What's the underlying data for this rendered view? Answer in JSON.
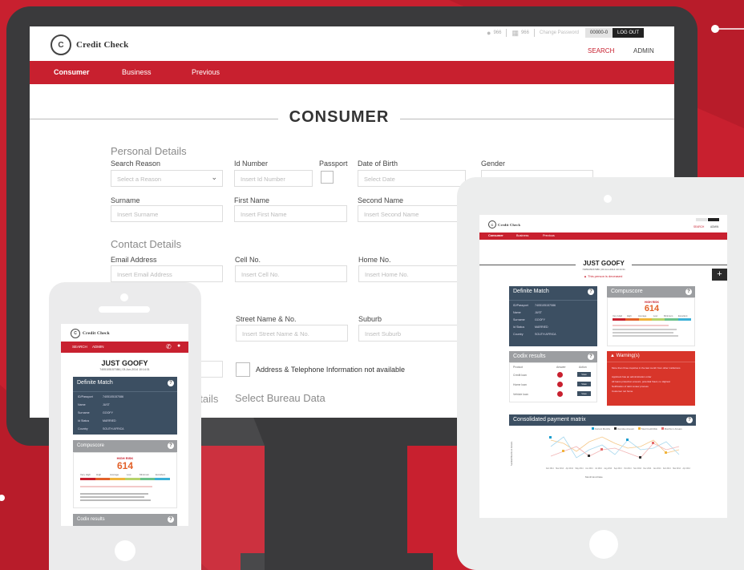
{
  "brand": {
    "name": "Credit Check"
  },
  "colors": {
    "brand_red": "#c8202f",
    "device_dark": "#3a3a3c",
    "device_light": "#ebebec",
    "navy": "#3c4f62",
    "gray_head": "#9c9ea1"
  },
  "desktop": {
    "header": {
      "user_count": "966",
      "branch_count": "966",
      "change_password": "Change Password",
      "code": "00000-0",
      "logout": "LOG OUT",
      "search_link": "SEARCH",
      "admin_link": "ADMIN"
    },
    "nav": [
      {
        "label": "Consumer"
      },
      {
        "label": "Business"
      },
      {
        "label": "Previous"
      }
    ],
    "page_title": "CONSUMER",
    "personal_details": {
      "title": "Personal Details",
      "search_reason": {
        "label": "Search Reason",
        "placeholder": "Select a Reason"
      },
      "id_number": {
        "label": "Id Number",
        "placeholder": "Insert Id Number"
      },
      "passport": {
        "label": "Passport"
      },
      "dob": {
        "label": "Date of Birth",
        "placeholder": "Select Date"
      },
      "gender": {
        "label": "Gender"
      },
      "surname": {
        "label": "Surname",
        "placeholder": "Insert Surname"
      },
      "first_name": {
        "label": "First Name",
        "placeholder": "Insert First Name"
      },
      "second_name": {
        "label": "Second Name",
        "placeholder": "Insert Second Name"
      }
    },
    "contact_details": {
      "title": "Contact Details",
      "email": {
        "label": "Email Address",
        "placeholder": "Insert Email Address"
      },
      "cell": {
        "label": "Cell No.",
        "placeholder": "Insert Cell No."
      },
      "home": {
        "label": "Home No.",
        "placeholder": "Insert Home No."
      }
    },
    "address": {
      "street": {
        "label": "Street Name & No.",
        "placeholder": "Insert Street Name & No."
      },
      "suburb": {
        "label": "Suburb",
        "placeholder": "Insert Suburb"
      },
      "unavailable_label": "Address & Telephone Information not available"
    },
    "bureau": {
      "partial_title": "etails",
      "title": "Select Bureau Data"
    }
  },
  "tablet": {
    "name": "JUST GOOFY",
    "subtitle": "7405105157086 | 03-Jun-2014 10:14:31",
    "deceased": "This person is deceased",
    "plus": "+",
    "definite_match": {
      "title": "Definite Match",
      "rows": [
        [
          "ID/Passport",
          "7405105157086"
        ],
        [
          "Name",
          "JUST"
        ],
        [
          "Surname",
          "GOOFY"
        ],
        [
          "Id Status",
          "MARRIED"
        ],
        [
          "Country",
          "SOUTH AFRICA"
        ]
      ]
    },
    "compuscore": {
      "title": "Compuscore",
      "risk": "HIGH RISK",
      "score": "614",
      "risk_labels": [
        "Very High",
        "High",
        "Average",
        "Low",
        "Minimum",
        "Excellent"
      ]
    },
    "codix": {
      "title": "Codix results",
      "cols": [
        "Product",
        "Answer",
        "Action"
      ],
      "rows": [
        "Credit loan",
        "Home loan",
        "Vehicle loan"
      ],
      "view": "View"
    },
    "warnings": {
      "title": "Warning(s)",
      "items": [
        "More than three inquiries in the last month from other institutions",
        "Applicant has an administration order",
        "All loans protection amount, potential fraud, no Highest",
        "Notification of debt review process",
        "Customer not home"
      ]
    },
    "payment_matrix": {
      "title": "Consolidated payment matrix",
      "legend": [
        "Current Months",
        "Overdue Amount",
        "Total Credit Risk",
        "Months in Arrears"
      ],
      "ylabel": "Number/Months in Arrears",
      "xlabel": "Month End Date",
      "months": [
        "Feb 2014",
        "Mar 2014",
        "Apr 2014",
        "May 2014",
        "Jun 2014",
        "Jul 2014",
        "Aug 2014",
        "Sep 2014",
        "Oct 2014",
        "Nov 2014",
        "Dec 2014",
        "Jan 2014",
        "Feb 2014",
        "Mar 2014",
        "Apr 2014"
      ]
    }
  },
  "phone": {
    "nav": [
      {
        "label": "SEARCH"
      },
      {
        "label": "ADMIN"
      }
    ],
    "name": "JUST GOOFY",
    "subtitle": "7405105157086 | 03-Jun-2014 10:14:31",
    "definite_match": {
      "title": "Definite Match",
      "rows": [
        [
          "ID/Passport",
          "7405105157086"
        ],
        [
          "Name",
          "JUST"
        ],
        [
          "Surname",
          "GOOFY"
        ],
        [
          "Id Status",
          "MARRIED"
        ],
        [
          "Country",
          "SOUTH AFRICA"
        ]
      ]
    },
    "compuscore": {
      "title": "Compuscore",
      "risk": "HIGH RISK",
      "score": "614",
      "risk_labels": [
        "Very High",
        "High",
        "Average",
        "Low",
        "Minimum",
        "Excellent"
      ]
    },
    "codix": {
      "title": "Codix results"
    }
  }
}
